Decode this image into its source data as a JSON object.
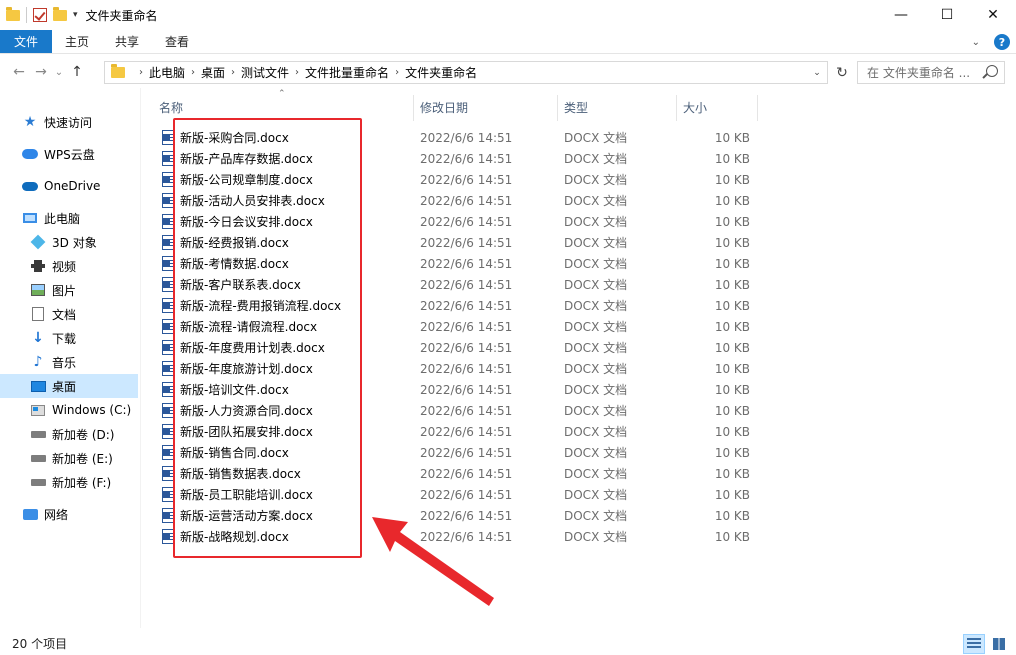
{
  "window": {
    "title": "文件夹重命名",
    "controls": {
      "minimize": "—",
      "maximize": "☐",
      "close": "✕"
    }
  },
  "qat": {
    "dropdown": "▾"
  },
  "ribbon": {
    "tabs": [
      {
        "label": "文件"
      },
      {
        "label": "主页"
      },
      {
        "label": "共享"
      },
      {
        "label": "查看"
      }
    ],
    "help": "?",
    "collapse": "⌄"
  },
  "nav": {
    "back": "←",
    "forward": "→",
    "recent": "⌄",
    "up": "↑"
  },
  "address": {
    "crumbs": [
      "此电脑",
      "桌面",
      "测试文件",
      "文件批量重命名",
      "文件夹重命名"
    ],
    "separator": "›",
    "dropdown": "⌄",
    "refresh": "↻"
  },
  "search": {
    "placeholder": "在 文件夹重命名 ..."
  },
  "sidebar": {
    "items": [
      {
        "label": "快速访问",
        "icon": "star-icon"
      },
      {
        "label": "WPS云盘",
        "icon": "cloud-icon"
      },
      {
        "label": "OneDrive",
        "icon": "onedrive-icon"
      },
      {
        "label": "此电脑",
        "icon": "computer-icon"
      },
      {
        "label": "3D 对象",
        "icon": "3d-objects-icon"
      },
      {
        "label": "视频",
        "icon": "video-icon"
      },
      {
        "label": "图片",
        "icon": "pictures-icon"
      },
      {
        "label": "文档",
        "icon": "documents-icon"
      },
      {
        "label": "下载",
        "icon": "download-icon"
      },
      {
        "label": "音乐",
        "icon": "music-icon"
      },
      {
        "label": "桌面",
        "icon": "desktop-icon",
        "selected": true
      },
      {
        "label": "Windows (C:)",
        "icon": "windows-drive-icon"
      },
      {
        "label": "新加卷 (D:)",
        "icon": "drive-icon"
      },
      {
        "label": "新加卷 (E:)",
        "icon": "drive-icon"
      },
      {
        "label": "新加卷 (F:)",
        "icon": "drive-icon"
      },
      {
        "label": "网络",
        "icon": "network-icon"
      }
    ]
  },
  "columns": {
    "name": "名称",
    "date": "修改日期",
    "type": "类型",
    "size": "大小",
    "sort": "⌃"
  },
  "files": [
    {
      "name": "新版-采购合同.docx",
      "date": "2022/6/6 14:51",
      "type": "DOCX 文档",
      "size": "10 KB"
    },
    {
      "name": "新版-产品库存数据.docx",
      "date": "2022/6/6 14:51",
      "type": "DOCX 文档",
      "size": "10 KB"
    },
    {
      "name": "新版-公司规章制度.docx",
      "date": "2022/6/6 14:51",
      "type": "DOCX 文档",
      "size": "10 KB"
    },
    {
      "name": "新版-活动人员安排表.docx",
      "date": "2022/6/6 14:51",
      "type": "DOCX 文档",
      "size": "10 KB"
    },
    {
      "name": "新版-今日会议安排.docx",
      "date": "2022/6/6 14:51",
      "type": "DOCX 文档",
      "size": "10 KB"
    },
    {
      "name": "新版-经费报销.docx",
      "date": "2022/6/6 14:51",
      "type": "DOCX 文档",
      "size": "10 KB"
    },
    {
      "name": "新版-考情数据.docx",
      "date": "2022/6/6 14:51",
      "type": "DOCX 文档",
      "size": "10 KB"
    },
    {
      "name": "新版-客户联系表.docx",
      "date": "2022/6/6 14:51",
      "type": "DOCX 文档",
      "size": "10 KB"
    },
    {
      "name": "新版-流程-费用报销流程.docx",
      "date": "2022/6/6 14:51",
      "type": "DOCX 文档",
      "size": "10 KB"
    },
    {
      "name": "新版-流程-请假流程.docx",
      "date": "2022/6/6 14:51",
      "type": "DOCX 文档",
      "size": "10 KB"
    },
    {
      "name": "新版-年度费用计划表.docx",
      "date": "2022/6/6 14:51",
      "type": "DOCX 文档",
      "size": "10 KB"
    },
    {
      "name": "新版-年度旅游计划.docx",
      "date": "2022/6/6 14:51",
      "type": "DOCX 文档",
      "size": "10 KB"
    },
    {
      "name": "新版-培训文件.docx",
      "date": "2022/6/6 14:51",
      "type": "DOCX 文档",
      "size": "10 KB"
    },
    {
      "name": "新版-人力资源合同.docx",
      "date": "2022/6/6 14:51",
      "type": "DOCX 文档",
      "size": "10 KB"
    },
    {
      "name": "新版-团队拓展安排.docx",
      "date": "2022/6/6 14:51",
      "type": "DOCX 文档",
      "size": "10 KB"
    },
    {
      "name": "新版-销售合同.docx",
      "date": "2022/6/6 14:51",
      "type": "DOCX 文档",
      "size": "10 KB"
    },
    {
      "name": "新版-销售数据表.docx",
      "date": "2022/6/6 14:51",
      "type": "DOCX 文档",
      "size": "10 KB"
    },
    {
      "name": "新版-员工职能培训.docx",
      "date": "2022/6/6 14:51",
      "type": "DOCX 文档",
      "size": "10 KB"
    },
    {
      "name": "新版-运营活动方案.docx",
      "date": "2022/6/6 14:51",
      "type": "DOCX 文档",
      "size": "10 KB"
    },
    {
      "name": "新版-战略规划.docx",
      "date": "2022/6/6 14:51",
      "type": "DOCX 文档",
      "size": "10 KB"
    }
  ],
  "status": {
    "item_count": "20 个项目"
  },
  "colors": {
    "accent": "#1979ca",
    "highlight": "#e8282c",
    "selection": "#cce8ff"
  }
}
